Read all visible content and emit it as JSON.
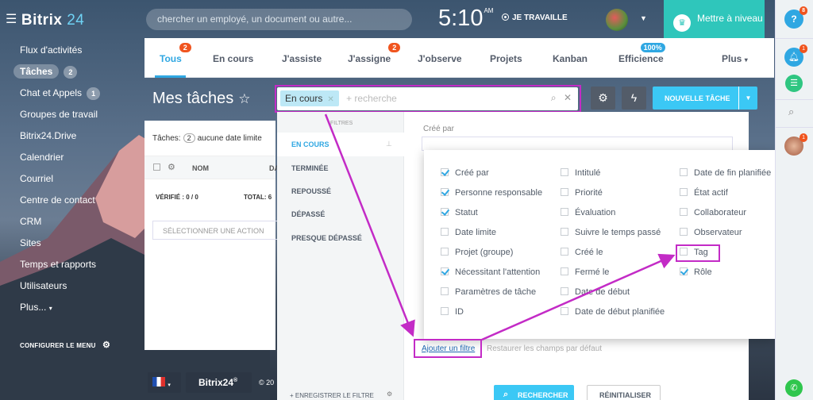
{
  "app": {
    "logo_name": "Bitrix",
    "logo_num": "24"
  },
  "header": {
    "search_placeholder": "chercher un employé, un document ou autre...",
    "time": "5:10",
    "ampm": "AM",
    "status": "JE TRAVAILLE",
    "upgrade_label": "Mettre à niveau"
  },
  "sidebar": {
    "items": [
      {
        "label": "Flux d'activités",
        "badge": ""
      },
      {
        "label": "Tâches",
        "badge": "2"
      },
      {
        "label": "Chat et Appels",
        "badge": "1"
      },
      {
        "label": "Groupes de travail",
        "badge": ""
      },
      {
        "label": "Bitrix24.Drive",
        "badge": ""
      },
      {
        "label": "Calendrier",
        "badge": ""
      },
      {
        "label": "Courriel",
        "badge": ""
      },
      {
        "label": "Centre de contact",
        "badge": ""
      },
      {
        "label": "CRM",
        "badge": ""
      },
      {
        "label": "Sites",
        "badge": ""
      },
      {
        "label": "Temps et rapports",
        "badge": ""
      },
      {
        "label": "Utilisateurs",
        "badge": ""
      },
      {
        "label": "Plus...",
        "badge": ""
      }
    ],
    "configure_label": "CONFIGURER LE MENU"
  },
  "tabs": [
    {
      "label": "Tous",
      "count": "2"
    },
    {
      "label": "En cours",
      "count": ""
    },
    {
      "label": "J'assiste",
      "count": ""
    },
    {
      "label": "J'assigne",
      "count": "2"
    },
    {
      "label": "J'observe",
      "count": ""
    },
    {
      "label": "Projets",
      "count": ""
    },
    {
      "label": "Kanban",
      "count": ""
    },
    {
      "label": "Efficience",
      "count": "100%"
    },
    {
      "label": "Plus",
      "count": ""
    }
  ],
  "page": {
    "title": "Mes tâches",
    "new_task_label": "NOUVELLE TÂCHE"
  },
  "filter": {
    "chip": "En cours",
    "placeholder": "+ recherche"
  },
  "grid": {
    "tasks_label": "Tâches:",
    "tasks_count": "2",
    "tasks_suffix": "aucune date limite",
    "col_name": "NOM",
    "col_date": "DA",
    "verified": "VÉRIFIÉ : 0 / 0",
    "total": "TOTAL: 6",
    "action_select": "SÉLECTIONNER UNE ACTION"
  },
  "footer": {
    "b24": "Bitrix24",
    "copyright": "© 20"
  },
  "filter_panel": {
    "section_label": "FILTRES",
    "presets": [
      "EN COURS",
      "TERMINÉE",
      "REPOUSSÉ",
      "DÉPASSÉ",
      "PRESQUE DÉPASSÉ"
    ],
    "save_label": "+ ENREGISTRER LE FILTRE",
    "created_by_label": "Créé par",
    "search_button": "RECHERCHER",
    "reset_button": "RÉINITIALISER",
    "add_filter": "Ajouter un filtre",
    "restore": "Restaurer les champs par défaut"
  },
  "fields": [
    {
      "label": "Créé par",
      "checked": true
    },
    {
      "label": "Personne responsable",
      "checked": true
    },
    {
      "label": "Statut",
      "checked": true
    },
    {
      "label": "Date limite",
      "checked": false
    },
    {
      "label": "Projet (groupe)",
      "checked": false
    },
    {
      "label": "Nécessitant l'attention",
      "checked": true
    },
    {
      "label": "Paramètres de tâche",
      "checked": false
    },
    {
      "label": "ID",
      "checked": false
    },
    {
      "label": "Intitulé",
      "checked": false
    },
    {
      "label": "Priorité",
      "checked": false
    },
    {
      "label": "Évaluation",
      "checked": false
    },
    {
      "label": "Suivre le temps passé",
      "checked": false
    },
    {
      "label": "Créé le",
      "checked": false
    },
    {
      "label": "Fermé le",
      "checked": false
    },
    {
      "label": "Date de début",
      "checked": false
    },
    {
      "label": "Date de début planifiée",
      "checked": false
    },
    {
      "label": "Date de fin planifiée",
      "checked": false
    },
    {
      "label": "État actif",
      "checked": false
    },
    {
      "label": "Collaborateur",
      "checked": false
    },
    {
      "label": "Observateur",
      "checked": false
    },
    {
      "label": "Tag",
      "checked": false
    },
    {
      "label": "Rôle",
      "checked": true
    }
  ],
  "rightbar": {
    "help_count": "8",
    "bell_count": "1",
    "avatar_count": "1"
  },
  "colors": {
    "accent": "#2fa7e2",
    "highlight": "#c32bc6",
    "upgrade": "#2fc6bb",
    "badge": "#f0541e"
  }
}
